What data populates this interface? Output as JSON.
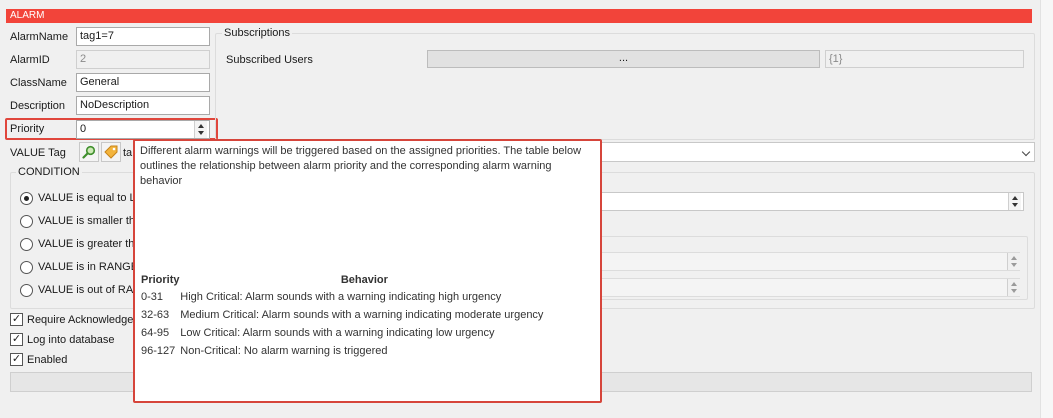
{
  "window": {
    "title": "ALARM"
  },
  "form": {
    "alarm_name": {
      "label": "AlarmName",
      "value": "tag1=7"
    },
    "alarm_id": {
      "label": "AlarmID",
      "value": "2"
    },
    "class_name": {
      "label": "ClassName",
      "value": "General"
    },
    "description": {
      "label": "Description",
      "value": "NoDescription"
    },
    "priority": {
      "label": "Priority",
      "value": "0"
    },
    "value_tag": {
      "label": "VALUE Tag",
      "partial_text": "ta"
    }
  },
  "subscriptions": {
    "group_title": "Subscriptions",
    "users_label": "Subscribed Users",
    "button_label": "...",
    "count": "{1}"
  },
  "condition": {
    "group_title": "CONDITION",
    "options": [
      {
        "label": "VALUE is equal to LI",
        "checked": true
      },
      {
        "label": "VALUE is smaller tha",
        "checked": false
      },
      {
        "label": "VALUE is greater th",
        "checked": false
      },
      {
        "label": "VALUE is in RANGE",
        "checked": false
      },
      {
        "label": "VALUE is out of RAN",
        "checked": false
      }
    ]
  },
  "checkboxes": [
    {
      "label": "Require Acknowledge",
      "checked": true
    },
    {
      "label": "Log into database",
      "checked": true
    },
    {
      "label": "Enabled",
      "checked": true
    }
  ],
  "tooltip": {
    "intro": "Different alarm warnings will be triggered based on the assigned priorities. The table below outlines the relationship between alarm priority and the corresponding alarm warning behavior",
    "headers": {
      "priority": "Priority",
      "behavior": "Behavior"
    },
    "rows": [
      {
        "priority": "0-31",
        "behavior": "High Critical: Alarm sounds with a warning indicating high urgency"
      },
      {
        "priority": "32-63",
        "behavior": "Medium Critical: Alarm sounds with a warning indicating moderate urgency"
      },
      {
        "priority": "64-95",
        "behavior": "Low Critical: Alarm sounds with a warning indicating low urgency"
      },
      {
        "priority": "96-127",
        "behavior": "Non-Critical: No alarm warning is triggered"
      }
    ]
  },
  "icons": {
    "search": "magnifier-icon",
    "tag": "tag-icon",
    "dropdown": "chevron-down-icon"
  },
  "colors": {
    "title_bar": "#f2443a",
    "highlight": "#e0463c"
  }
}
